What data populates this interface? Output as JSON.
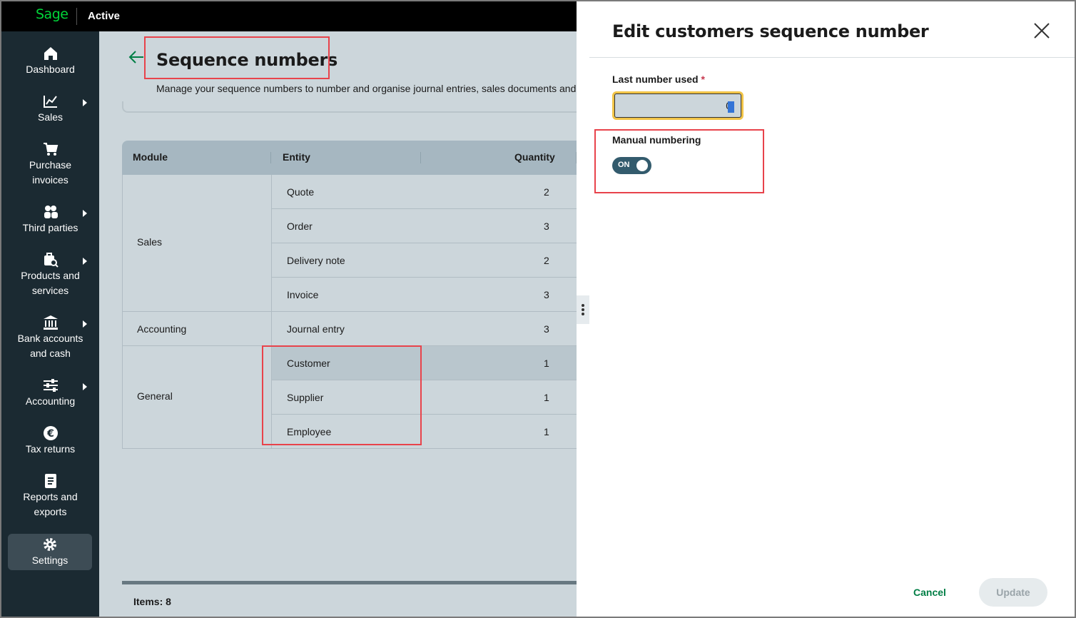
{
  "app": {
    "logo": "Sage",
    "status": "Active"
  },
  "sidebar": {
    "items": [
      {
        "label": "Dashboard",
        "icon": "home-icon"
      },
      {
        "label": "Sales",
        "icon": "chart-line-icon"
      },
      {
        "label": "Purchase invoices",
        "icon": "shopping-cart-icon"
      },
      {
        "label": "Third parties",
        "icon": "people-icon"
      },
      {
        "label": "Products and services",
        "icon": "product-search-icon"
      },
      {
        "label": "Bank accounts and cash",
        "icon": "bank-icon"
      },
      {
        "label": "Accounting",
        "icon": "sliders-icon"
      },
      {
        "label": "Tax returns",
        "icon": "euro-icon"
      },
      {
        "label": "Reports and exports",
        "icon": "report-icon"
      },
      {
        "label": "Settings",
        "icon": "gear-icon",
        "active": true
      }
    ]
  },
  "page": {
    "title": "Sequence numbers",
    "description": "Manage your sequence numbers to number and organise journal entries, sales documents and th"
  },
  "table": {
    "headers": {
      "module": "Module",
      "entity": "Entity",
      "quantity": "Quantity"
    },
    "groups": [
      {
        "module": "Sales",
        "rows": [
          {
            "entity": "Quote",
            "quantity": "2"
          },
          {
            "entity": "Order",
            "quantity": "3"
          },
          {
            "entity": "Delivery note",
            "quantity": "2"
          },
          {
            "entity": "Invoice",
            "quantity": "3"
          }
        ]
      },
      {
        "module": "Accounting",
        "rows": [
          {
            "entity": "Journal entry",
            "quantity": "3"
          }
        ]
      },
      {
        "module": "General",
        "rows": [
          {
            "entity": "Customer",
            "quantity": "1",
            "selected": true
          },
          {
            "entity": "Supplier",
            "quantity": "1"
          },
          {
            "entity": "Employee",
            "quantity": "1"
          }
        ]
      }
    ],
    "footer": "Items: 8"
  },
  "panel": {
    "title": "Edit customers sequence number",
    "last_number_label": "Last number used",
    "required_mark": "*",
    "last_number_value": "0",
    "manual_numbering_label": "Manual numbering",
    "toggle_state": "ON",
    "cancel_label": "Cancel",
    "update_label": "Update"
  },
  "colors": {
    "brand_green": "#00d639",
    "sidebar_bg": "#1b2a32",
    "toggle_on": "#335b6d",
    "annotation_red": "#e8434b",
    "focus_yellow": "#f1c447"
  }
}
